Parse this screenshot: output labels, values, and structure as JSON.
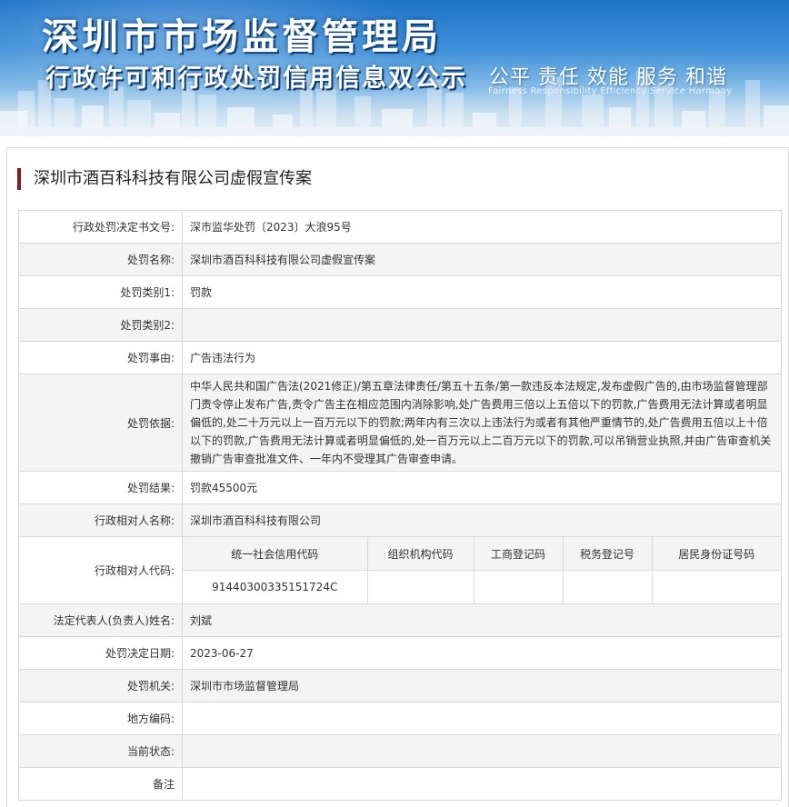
{
  "banner": {
    "title": "深圳市市场监督管理局",
    "subtitle": "行政许可和行政处罚信用信息双公示",
    "slogan": "公平  责任  效能  服务  和谐",
    "slogan_en": "Fairness Responsibility Efficiency Service Harmony"
  },
  "case": {
    "title": "深圳市酒百科科技有限公司虚假宣传案"
  },
  "rows": [
    {
      "label": "行政处罚决定书文号:",
      "value": "深市监华处罚〔2023〕大浪95号"
    },
    {
      "label": "处罚名称:",
      "value": "深圳市酒百科科技有限公司虚假宣传案"
    },
    {
      "label": "处罚类别1:",
      "value": "罚款"
    },
    {
      "label": "处罚类别2:",
      "value": ""
    },
    {
      "label": "处罚事由:",
      "value": "广告违法行为"
    },
    {
      "label": "处罚依据:",
      "value": "中华人民共和国广告法(2021修正)/第五章法律责任/第五十五条/第一款违反本法规定,发布虚假广告的,由市场监督管理部门责令停止发布广告,责令广告主在相应范围内消除影响,处广告费用三倍以上五倍以下的罚款,广告费用无法计算或者明显偏低的,处二十万元以上一百万元以下的罚款;两年内有三次以上违法行为或者有其他严重情节的,处广告费用五倍以上十倍以下的罚款,广告费用无法计算或者明显偏低的,处一百万元以上二百万元以下的罚款,可以吊销营业执照,并由广告审查机关撤销广告审查批准文件、一年内不受理其广告审查申请。"
    },
    {
      "label": "处罚结果:",
      "value": "罚款45500元"
    },
    {
      "label": "行政相对人名称:",
      "value": "深圳市酒百科科技有限公司"
    },
    {
      "label": "行政相对人代码:",
      "value": ""
    },
    {
      "label": "法定代表人(负责人)姓名:",
      "value": "刘斌"
    },
    {
      "label": "处罚决定日期:",
      "value": "2023-06-27"
    },
    {
      "label": "处罚机关:",
      "value": "深圳市市场监督管理局"
    },
    {
      "label": "地方编码:",
      "value": ""
    },
    {
      "label": "当前状态:",
      "value": ""
    },
    {
      "label": "备注",
      "value": ""
    }
  ],
  "codes": {
    "headers": [
      "统一社会信用代码",
      "组织机构代码",
      "工商登记码",
      "税务登记号",
      "居民身份证号码"
    ],
    "values": [
      "91440300335151724C",
      "",
      "",
      "",
      ""
    ]
  }
}
